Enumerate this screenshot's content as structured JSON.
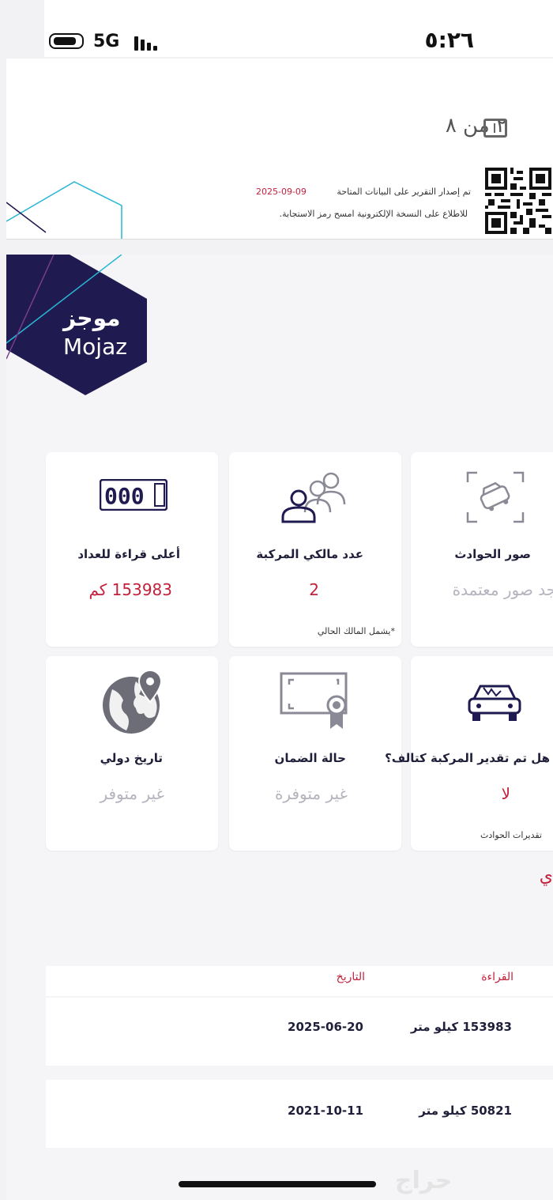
{
  "status_bar": {
    "time": "٥:٢٦",
    "network": "5G"
  },
  "report_page": {
    "page_counter": "٢ من ٨",
    "issued_text": "تم إصدار التقرير على البيانات المتاحة",
    "issued_date": "2025-09-09",
    "qr_note": "للاطلاع على النسخة الإلكترونية امسح رمز الاستجابة."
  },
  "brand": {
    "name_ar": "موجز",
    "name_en": "Mojaz"
  },
  "cards": {
    "odometer": {
      "title": "أعلى قراءة للعداد",
      "value": "153983 كم",
      "icon": "odometer-icon"
    },
    "owners": {
      "title": "عدد مالكي المركبة",
      "value": "2",
      "note": "*يشمل المالك الحالي",
      "icon": "owners-icon"
    },
    "accident_photos": {
      "title": "صور الحوادث",
      "value": "يوجد صور معتمدة",
      "icon": "accident-photo-icon"
    },
    "international": {
      "title": "تاريخ دولي",
      "value": "غير متوفر",
      "icon": "globe-pin-icon"
    },
    "warranty": {
      "title": "حالة الضمان",
      "value": "غير متوفرة",
      "icon": "certificate-icon"
    },
    "total_loss": {
      "title": "هل تم تقدير المركبة كتالف؟",
      "value": "لا",
      "note": "تقديرات الحوادث",
      "icon": "damaged-car-icon"
    }
  },
  "partial_heading": "ي",
  "odometer_table": {
    "headers": {
      "reading": "القراءة",
      "date": "التاريخ"
    },
    "rows": [
      {
        "reading": "153983 كيلو متر",
        "date": "2025-06-20"
      },
      {
        "reading": "50821 كيلو متر",
        "date": "2021-10-11"
      }
    ]
  },
  "watermark": "حراج",
  "colors": {
    "accent_red": "#c41f3b",
    "navy": "#1f1a4f",
    "cyan": "#29b6d6"
  }
}
